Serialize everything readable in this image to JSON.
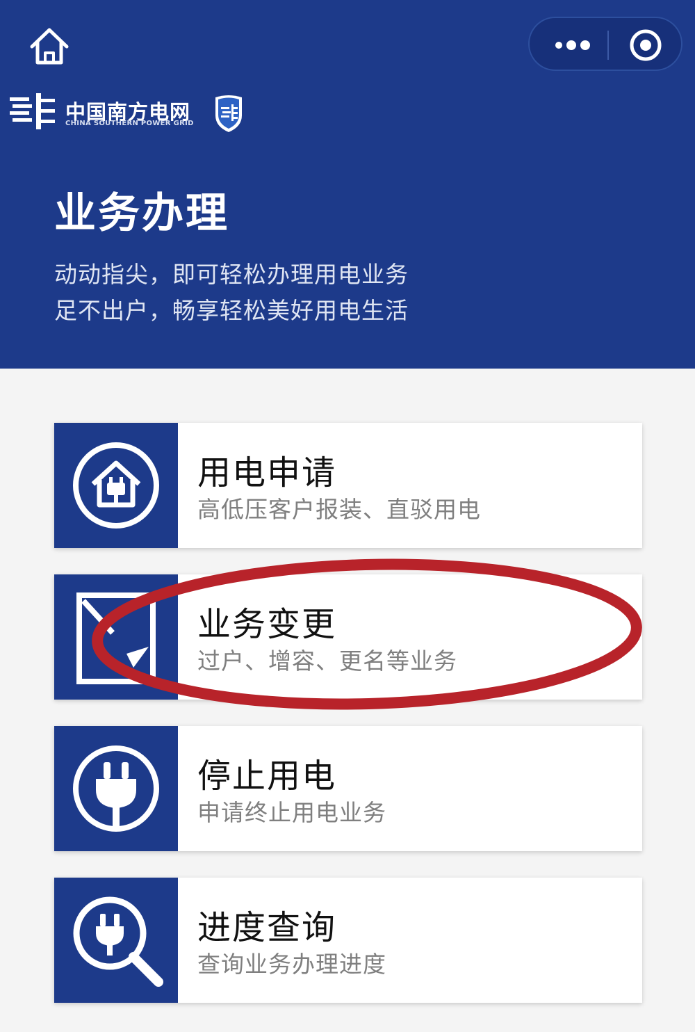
{
  "colors": {
    "brand_blue": "#1d3a8a",
    "highlight_red": "#b8232a",
    "background": "#f4f4f4"
  },
  "nav": {
    "home_icon": "home-icon",
    "more_icon": "more-icon",
    "close_icon": "target-close-icon"
  },
  "logo": {
    "cn": "中国南方电网",
    "en": "CHINA SOUTHERN POWER GRID"
  },
  "header": {
    "title": "业务办理",
    "subtitle_lines": [
      "动动指尖，即可轻松办理用电业务",
      "足不出户，畅享轻松美好用电生活"
    ]
  },
  "services": [
    {
      "icon": "house-plug-icon",
      "title": "用电申请",
      "desc": "高低压客户报装、直驳用电"
    },
    {
      "icon": "document-edit-icon",
      "title": "业务变更",
      "desc": "过户、增容、更名等业务"
    },
    {
      "icon": "plug-icon",
      "title": "停止用电",
      "desc": "申请终止用电业务"
    },
    {
      "icon": "search-plug-icon",
      "title": "进度查询",
      "desc": "查询业务办理进度"
    }
  ]
}
